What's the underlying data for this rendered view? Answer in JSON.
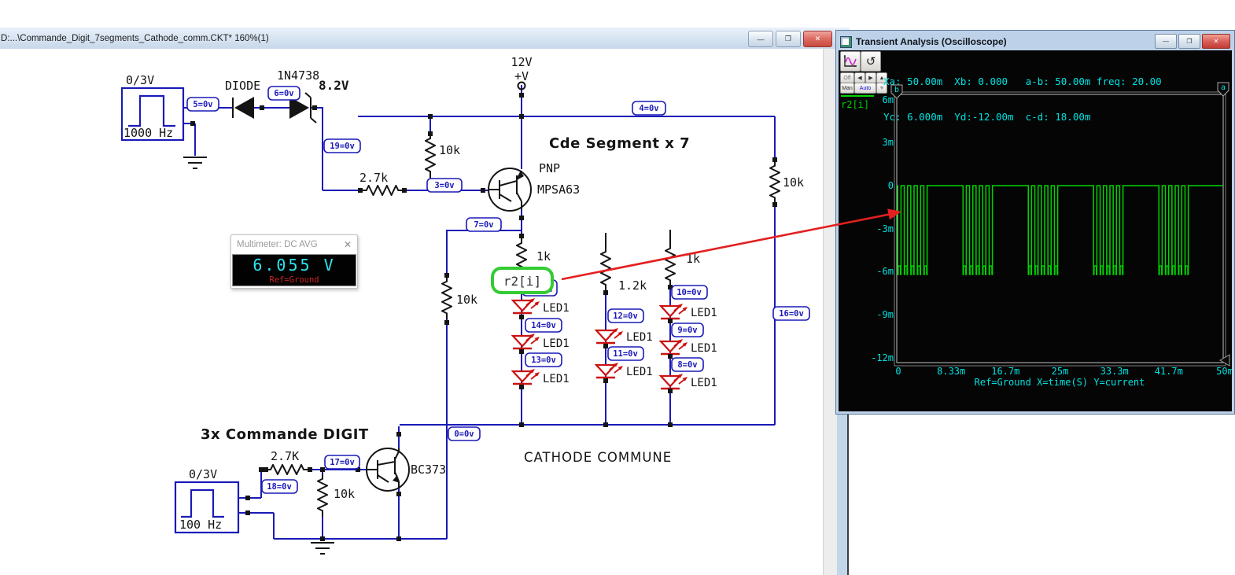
{
  "main_window": {
    "title": "D:...\\Commande_Digit_7segments_Cathode_comm.CKT* 160%(1)"
  },
  "scope": {
    "title": "Transient Analysis (Oscilloscope)",
    "readout_line1": "Xa: 50.00m  Xb: 0.000   a-b: 50.00m freq: 20.00",
    "readout_line2": "Yc: 6.000m  Yd:-12.00m  c-d: 18.00m",
    "legend": "r2[i]",
    "toolbar": {
      "off": "Off",
      "man": "Man",
      "auto": "Auto"
    },
    "cursor_a": "a",
    "cursor_b": "b"
  },
  "multimeter": {
    "title": "Multimeter: DC AVG",
    "value": "6.055 V",
    "ref": "Ref=Ground"
  },
  "chart_data": {
    "type": "line",
    "title": "Transient Analysis (Oscilloscope)",
    "xlabel": "X=time(S)",
    "ylabel": "Y=current",
    "footer": "Ref=Ground  X=time(S) Y=current",
    "x_range_ms": [
      0,
      50
    ],
    "y_range_mA": [
      -12,
      6
    ],
    "x_ticks": [
      "0",
      "8.33m",
      "16.7m",
      "25m",
      "33.3m",
      "41.7m",
      "50m"
    ],
    "y_ticks": [
      "6m",
      "3m",
      "0",
      "-3m",
      "-6m",
      "-9m",
      "-12m"
    ],
    "grid": false,
    "legend_position": "top-left",
    "readouts": {
      "Xa": "50.00m",
      "Xb": "0.000",
      "a-b": "50.00m",
      "freq": "20.00",
      "Yc": "6.000m",
      "Yd": "-12.00m",
      "c-d": "18.00m"
    },
    "series": [
      {
        "name": "r2[i]",
        "color": "#00d300",
        "waveform": {
          "description": "bursts of 1 kHz current pulses gated at 100 Hz; 0 A between bursts",
          "burst_count": 5,
          "burst_period_ms": 10,
          "pulses_per_burst": 5,
          "pulse_period_ms": 1,
          "pulse_low_ms": 0.5,
          "start_offset_ms": 0.15,
          "high_mA": 0,
          "low_mA": -5.6,
          "spike_mA": -6.2
        }
      }
    ]
  },
  "schematic": {
    "heading_segment": "Cde Segment  x 7",
    "heading_digit": "3x Commande DIGIT",
    "heading_cathode": "CATHODE COMMUNE",
    "source_top": {
      "level": "0/3V",
      "freq": "1000 Hz"
    },
    "source_bottom": {
      "level": "0/3V",
      "freq": "100 Hz"
    },
    "supply": {
      "voltage": "12V",
      "terminal": "+V"
    },
    "d1": "DIODE",
    "zener": "1N4738",
    "zener_v": "8.2V",
    "q1_type": "PNP",
    "q1": "MPSA63",
    "q2": "BC373",
    "r_base_top": "2.7k",
    "r_pull_top": "10k",
    "r_right": "10k",
    "r_left": "10k",
    "r_col1": "1k",
    "r_col2": "1.2k",
    "r_col3": "1k",
    "r_base_bot": "2.7K",
    "r_pull_bot": "10k",
    "probe": "r2[i]",
    "probe_covered": "0v",
    "led": "LED1",
    "nodes": {
      "n5": "5=0v",
      "n6": "6=0v",
      "n19": "19=0v",
      "n3": "3=0v",
      "n4": "4=0v",
      "n7": "7=0v",
      "n14": "14=0v",
      "n13": "13=0v",
      "n12": "12=0v",
      "n11": "11=0v",
      "n10": "10=0v",
      "n9": "9=0v",
      "n8": "8=0v",
      "n16": "16=0v",
      "n0": "0=0v",
      "n17": "17=0v",
      "n18": "18=0v"
    }
  },
  "icons": {
    "minimize": "—",
    "restore": "❐",
    "close": "✕",
    "rotate": "↺",
    "left": "◀",
    "right": "▶",
    "up": "▲",
    "down": "▼"
  },
  "colors": {
    "wire": "#1a1ab8",
    "led": "#cc1111",
    "probe_green": "#33cc33",
    "arrow_red": "#e41f1f",
    "trace_green": "#00d300",
    "scope_cyan": "#00e2e2",
    "meter_cyan": "#2ee4ee",
    "meter_red": "#cc2222"
  }
}
